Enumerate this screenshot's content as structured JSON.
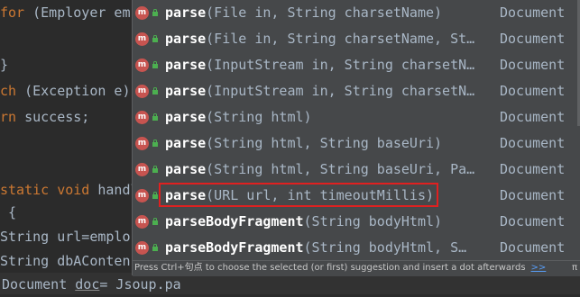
{
  "editor": {
    "lines": [
      {
        "kw": "for",
        "text": " (Employer em"
      },
      {
        "kw": "",
        "text": ""
      },
      {
        "kw": "",
        "text": "}"
      },
      {
        "kw": "ch",
        "text": " (Exception e)"
      },
      {
        "kw": "rn",
        "text": " success;"
      },
      {
        "kw": "",
        "text": ""
      },
      {
        "kw": "",
        "text": ""
      },
      {
        "kw": "static void",
        "text": " handl"
      },
      {
        "kw": "",
        "text": " {"
      },
      {
        "kw": "",
        "text": "String url=emplo"
      },
      {
        "kw": "",
        "text": "String dbAConten"
      }
    ],
    "current_line": {
      "type": "Document",
      "var": "doc",
      "rest": "= Jsoup.pa"
    }
  },
  "popup": {
    "items": [
      {
        "name": "parse",
        "params": "(File in, String charsetName)",
        "ret": "Document"
      },
      {
        "name": "parse",
        "params": "(File in, String charsetName, St…",
        "ret": "Document"
      },
      {
        "name": "parse",
        "params": "(InputStream in, String charsetN…",
        "ret": "Document"
      },
      {
        "name": "parse",
        "params": "(InputStream in, String charsetN…",
        "ret": "Document"
      },
      {
        "name": "parse",
        "params": "(String html)",
        "ret": "Document"
      },
      {
        "name": "parse",
        "params": "(String html, String baseUri)",
        "ret": "Document"
      },
      {
        "name": "parse",
        "params": "(String html, String baseUri, Pa…",
        "ret": "Document"
      },
      {
        "name": "parse",
        "params": "(URL url, int timeoutMillis)",
        "ret": "Document"
      },
      {
        "name": "parseBodyFragment",
        "params": "(String bodyHtml)",
        "ret": "Document"
      },
      {
        "name": "parseBodyFragment",
        "params": "(String bodyHtml, S…",
        "ret": "Document"
      }
    ],
    "method_icon_letter": "m",
    "hint": "Press Ctrl+句点 to choose the selected (or first) suggestion and insert a dot afterwards",
    "hint_link": ">>",
    "pi": "π"
  },
  "colors": {
    "highlight_box": "#e02020",
    "selected_row": "#0d293e",
    "keyword": "#cc7832"
  }
}
